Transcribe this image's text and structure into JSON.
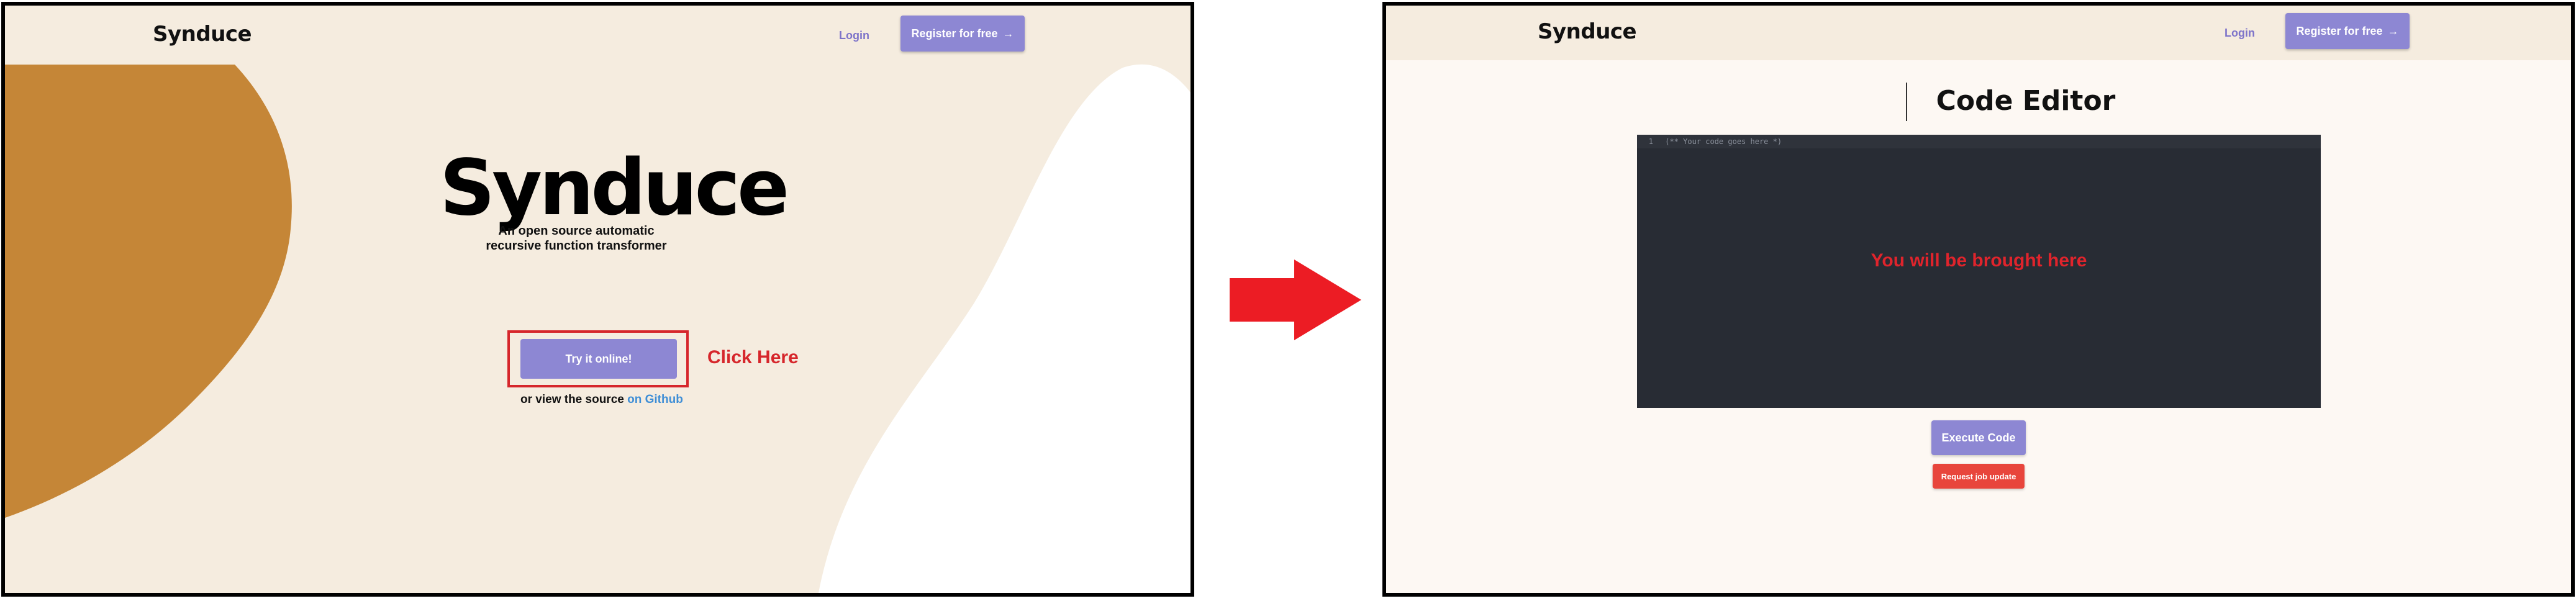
{
  "colors": {
    "page_bg": "#f5ecdf",
    "editor_page_bg": "#fdf8f3",
    "accent": "#8d87d3",
    "blob": "#c58637",
    "annotation_red": "#d6262b",
    "danger": "#e8453c",
    "editor_bg": "#282c34"
  },
  "landing": {
    "brand": "Synduce",
    "nav": {
      "login": "Login",
      "register": "Register for free",
      "register_icon": "→"
    },
    "hero": {
      "title": "Synduce",
      "subtitle_line1": "An open source automatic",
      "subtitle_line2": "recursive function transformer"
    },
    "try_button": "Try it online!",
    "annotation": "Click Here",
    "source_prefix": "or view the source",
    "source_link": "on Github"
  },
  "editor_page": {
    "brand": "Synduce",
    "nav": {
      "login": "Login",
      "register": "Register for free",
      "register_icon": "→"
    },
    "title": "Code Editor",
    "editor": {
      "line_number": "1",
      "placeholder": "(** Your code goes here *)",
      "annotation": "You will be brought here"
    },
    "execute_button": "Execute Code",
    "job_button": "Request job update"
  },
  "transition_icon": "right-arrow-icon"
}
